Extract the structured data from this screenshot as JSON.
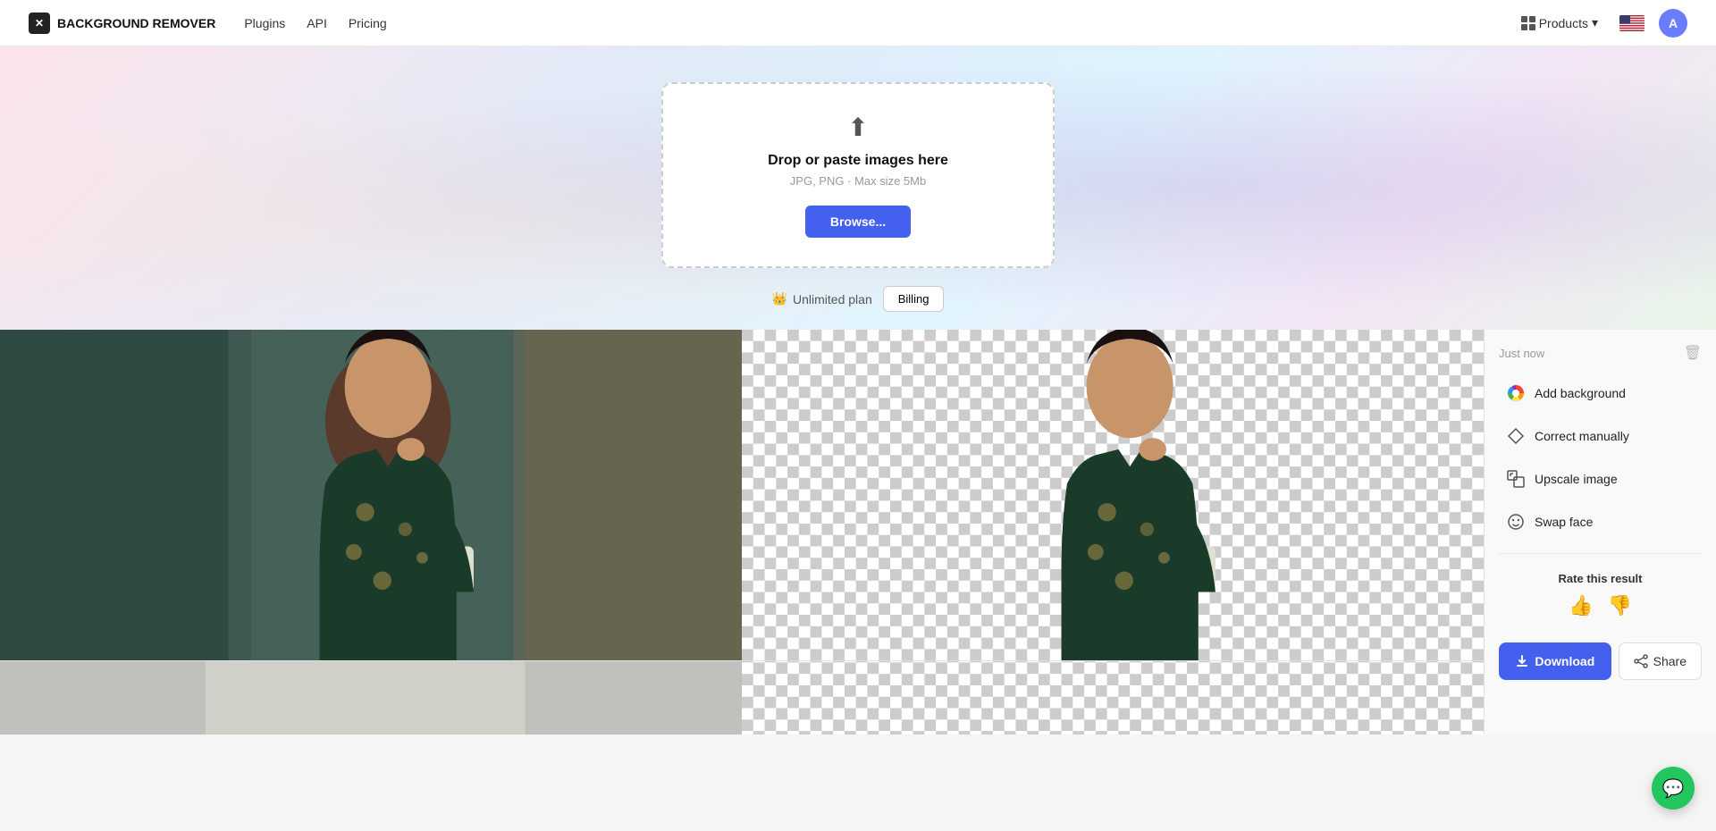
{
  "app": {
    "name": "BACKGROUND REMOVER",
    "logo_symbol": "✕"
  },
  "nav": {
    "links": [
      "Plugins",
      "API",
      "Pricing"
    ],
    "products_label": "Products",
    "avatar_letter": "A"
  },
  "upload": {
    "title": "Drop or paste images here",
    "subtitle": "JPG, PNG · Max size 5Mb",
    "browse_label": "Browse...",
    "icon": "⬆"
  },
  "plan": {
    "icon": "👑",
    "label": "Unlimited plan",
    "billing_label": "Billing"
  },
  "right_panel": {
    "timestamp": "Just now",
    "actions": [
      {
        "label": "Add background",
        "icon": "color_wheel"
      },
      {
        "label": "Correct manually",
        "icon": "diamond"
      },
      {
        "label": "Upscale image",
        "icon": "upscale"
      },
      {
        "label": "Swap face",
        "icon": "face"
      }
    ],
    "rate_title": "Rate this result",
    "thumbs_up": "👍",
    "thumbs_down": "👎",
    "download_label": "Download",
    "share_label": "Share"
  }
}
